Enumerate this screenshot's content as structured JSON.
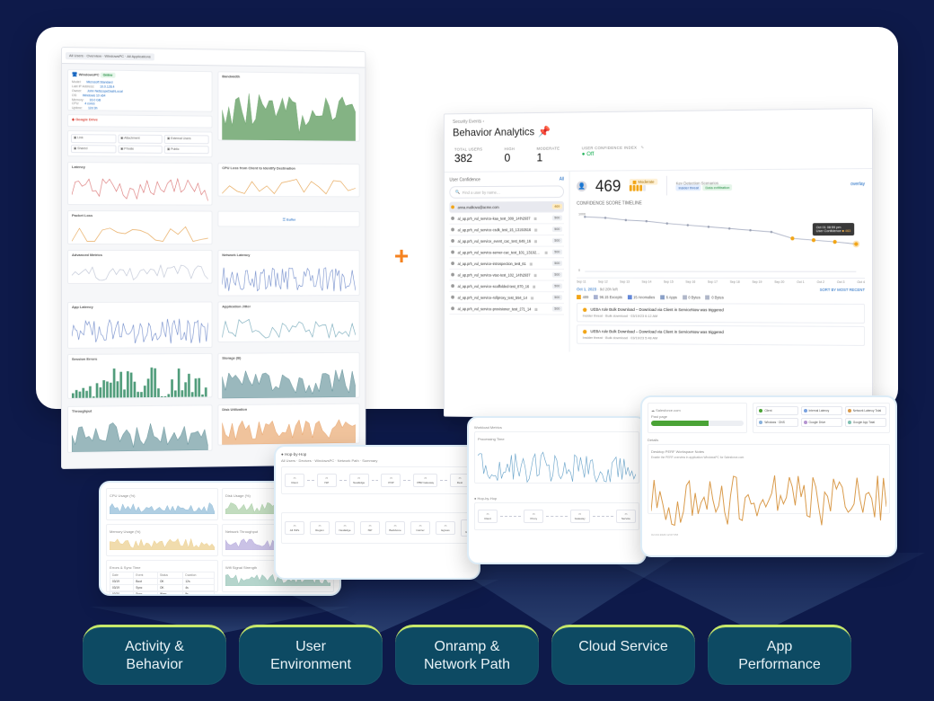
{
  "categories": [
    "Activity & Behavior",
    "User Environment",
    "Onramp & Network Path",
    "Cloud Service",
    "App Performance"
  ],
  "leftPanel": {
    "breadcrumb_pill": "All Users · Overview · WindowsPC · All Applications",
    "device": "WindowsPC",
    "device_badge": "Online",
    "meta": {
      "Model": "Microsoft Standard",
      "Last IP Address": "10.0.128.4",
      "Owner": "John NetscopeDashLocal",
      "OS": "Windows 10 x64",
      "Memory": "16.0 GB",
      "CPU": "4 cores",
      "Uptime": "12d 3h"
    },
    "drive": "Google Drive",
    "side_chips": [
      "Link",
      "Attachment",
      "External Users",
      "Shared",
      "Private",
      "Public"
    ],
    "charts": [
      {
        "t": "Bandwidth",
        "color": "#6ea66e",
        "h": 36,
        "fill": true
      },
      {
        "t": "Latency",
        "color": "#d86a6a",
        "h": 36
      },
      {
        "t": "CPU Loss from Client to Identify Destination",
        "color": "#e39a3f",
        "h": 26,
        "sparse": true
      },
      {
        "t": "Packet Loss",
        "color": "#e39a3f",
        "h": 26,
        "sparse": true
      },
      {
        "t": "Buffer button",
        "btn": "Buffer"
      },
      {
        "t": "Advanced Metrics",
        "color": "#b8bfd1",
        "h": 26
      },
      {
        "t": "Network Latency",
        "color": "#6a86c8",
        "h": 40,
        "dense": true
      },
      {
        "t": "App Latency",
        "color": "#6a86c8",
        "h": 40,
        "dense": true
      },
      {
        "t": "Application Jitter",
        "color": "#6aa2b4",
        "h": 34
      },
      {
        "t": "Session Errors",
        "color": "#4f9c7a",
        "h": 38,
        "bars": true
      },
      {
        "t": "Storage (B)",
        "color": "#477d86",
        "h": 40,
        "area": true
      },
      {
        "t": "Throughput",
        "color": "#477d86",
        "h": 40,
        "area": true,
        "grad": true
      },
      {
        "t": "Disk Utilization",
        "color": "#e3914b",
        "h": 34,
        "area": true
      }
    ]
  },
  "behavior": {
    "breadcrumb": "Security Events ›",
    "title": "Behavior Analytics",
    "stats": [
      {
        "lbl": "TOTAL USERS",
        "val": "382"
      },
      {
        "lbl": "HIGH",
        "val": "0"
      },
      {
        "lbl": "MODERATE",
        "val": "1"
      },
      {
        "lbl": "USER CONFIDENCE INDEX",
        "val": "Off",
        "pencil": true,
        "green": true
      }
    ],
    "userlist_title": "User Confidence",
    "userlist_filter": "All",
    "search_placeholder": "Find a user by name…",
    "active_user": "anna.malkova@acme.com",
    "active_score": "469",
    "users": [
      "al_ap.prh_vul_service-kaa_test_309_14th2937",
      "al_ap.prh_vul_service-csdk_test_15_13192616",
      "al_ap.prh_vul_service_event_cac_test_649_16",
      "al_ap.prh_vul_service-server-cac_test_101_13192616",
      "al_ap.prh_vul_service-introspection_test_61",
      "al_ap.prh_vul_service-vtac-test_102_14th2937",
      "al_ap.prh_vul_service-scaffolded-test_870_16",
      "al_ap.prh_vul_service-rollproxy_test_594_14",
      "al_ap.prh_vul_service-provisioner_test_271_14"
    ],
    "user_scores": [
      "500",
      "500",
      "500",
      "500",
      "500",
      "500",
      "500",
      "500",
      "500"
    ],
    "risk_score": "469",
    "risk_label": "Moderate",
    "kds_label": "Key Detection Scenarios",
    "kds_pill1": "Insider threat",
    "kds_pill2": "Data exfiltration",
    "overlay_link": "overlay",
    "timeline_title": "CONFIDENCE SCORE TIMELINE",
    "timeline_ymax": "1000",
    "timeline_ymid": "463",
    "ticks": [
      "Sep 11",
      "Sep 12",
      "Sep 13",
      "Sep 14",
      "Sep 15",
      "Sep 16",
      "Sep 17",
      "Sep 18",
      "Sep 19",
      "Sep 20",
      "Oct 1",
      "Oct 2",
      "Oct 3",
      "Oct 4"
    ],
    "tooltip_line1": "Oct 01 08:59 pm",
    "tooltip_line2": "User Confidence",
    "tooltip_val": "463",
    "footer_date": "Oct 1, 2023",
    "footer_info": "9d 20h left",
    "sort": "SORT BY MOST RECENT",
    "tags": [
      {
        "c": "#f2a516",
        "t": "409"
      },
      {
        "c": "#a7b1d1",
        "t": "96.15 Excepts"
      },
      {
        "c": "#6287d9",
        "t": "15 Anomalies"
      },
      {
        "c": "#8aa0c7",
        "t": "6 Apps"
      },
      {
        "c": "#b0b7c9",
        "t": "0 Bytes"
      },
      {
        "c": "#b0b7c9",
        "t": "0 Bytes"
      }
    ],
    "events": [
      {
        "h": "UEBA rule Bulk Download – Download via Client in ServiceNow was triggered",
        "s": "Insider threat · Bulk download · 03/19/23 6:12 AM"
      },
      {
        "h": "UEBA rule Bulk Download – Download via Client in ServiceNow was triggered",
        "s": "Insider threat · Bulk download · 03/19/23 5:48 AM"
      }
    ]
  },
  "chart_data": {
    "type": "line",
    "title": "CONFIDENCE SCORE TIMELINE",
    "ylabel": "CONFIDENCE SCORE",
    "ylim": [
      0,
      1000
    ],
    "x": [
      "Sep 11",
      "Sep 12",
      "Sep 13",
      "Sep 14",
      "Sep 15",
      "Sep 16",
      "Sep 17",
      "Sep 18",
      "Sep 19",
      "Sep 20",
      "Oct 1",
      "Oct 2",
      "Oct 3",
      "Oct 4"
    ],
    "series": [
      {
        "name": "User Confidence",
        "values": [
          940,
          920,
          880,
          860,
          820,
          790,
          760,
          730,
          700,
          670,
          560,
          530,
          500,
          463
        ]
      }
    ],
    "highlight": {
      "x": "Oct 4",
      "y": 463
    }
  },
  "card1": {
    "charts": [
      {
        "t": "CPU Usage (%)",
        "c": "#6fa7cc"
      },
      {
        "t": "Disk Usage (%)",
        "c": "#8fbf8a"
      },
      {
        "t": "Memory Usage (%)",
        "c": "#e6c06a"
      },
      {
        "t": "Network Throughput",
        "c": "#9e8fd1"
      },
      {
        "t": "Errors & Sync Time",
        "table": true
      },
      {
        "t": "Wifi Signal Strength",
        "c": "#79b3a2"
      }
    ],
    "table_cols": [
      "Date",
      "Event",
      "Status",
      "Duration"
    ],
    "table_rows": [
      [
        "03/19",
        "Boot",
        "OK",
        "12s"
      ],
      [
        "03/19",
        "Sync",
        "OK",
        "4s"
      ],
      [
        "03/20",
        "Sync",
        "Warn",
        "9s"
      ]
    ]
  },
  "card2": {
    "title": "Hop-by-Hop",
    "sub": "All Users · Devices · WindowsPC · Network Path · Summary",
    "hops_top": [
      "Client",
      "ISP",
      "NewEdge",
      "POP",
      "PBR Gateway",
      "Dest"
    ],
    "hops_bottom": [
      "All ISPs",
      "Region",
      "NewEdge",
      "ISP",
      "Backbone",
      "Carrier",
      "Egress",
      "Dest Gateway"
    ]
  },
  "card3": {
    "title": "Workload Metrics",
    "proc": "Processing Time",
    "sub2": "Hop-by-Hop"
  },
  "card4": {
    "app": "Salesforce.com",
    "score_lbl": "Past page",
    "legend": [
      {
        "c": "#4aa336",
        "t": "Client"
      },
      {
        "c": "#7aa2e0",
        "t": "Internal Latency"
      },
      {
        "c": "#d99a4a",
        "t": "Network Latency Total"
      },
      {
        "c": "#88b1db",
        "t": "Windows · DNS"
      },
      {
        "c": "#b594d0",
        "t": "Google Drive"
      },
      {
        "c": "#7ebfb1",
        "t": "Google App Total"
      }
    ],
    "details": "Details",
    "bottom_title": "Desktop PERF Workspace Notes",
    "bottom_sub": "Enable the PERF overview in application WindowsPC for Salesforce.com",
    "bottom_time": "Oct 04 2023 12:07 PM"
  }
}
